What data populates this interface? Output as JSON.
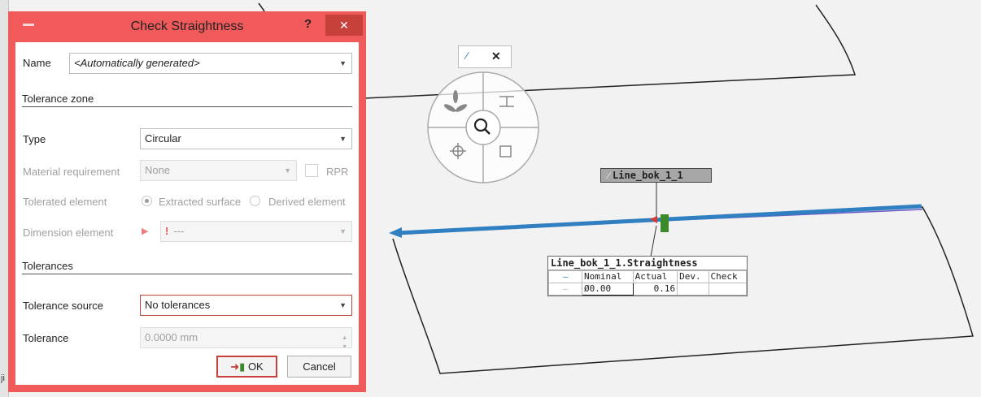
{
  "left_strip": {
    "char": "ji"
  },
  "dialog": {
    "title": "Check Straightness",
    "help_label": "?",
    "close_label": "✕",
    "name_label": "Name",
    "name_value": "<Automatically generated>",
    "tolerance_zone_heading": "Tolerance zone",
    "type_label": "Type",
    "type_value": "Circular",
    "material_requirement_label": "Material requirement",
    "material_requirement_value": "None",
    "rpr_label": "RPR",
    "tolerated_element_label": "Tolerated element",
    "tolerated_element_options": [
      "Extracted surface",
      "Derived element"
    ],
    "dimension_element_label": "Dimension element",
    "dimension_element_value": "---",
    "tolerances_heading": "Tolerances",
    "tolerance_source_label": "Tolerance source",
    "tolerance_source_value": "No tolerances",
    "tolerance_label": "Tolerance",
    "tolerance_value": "0.0000 mm",
    "ok_label": "OK",
    "cancel_label": "Cancel"
  },
  "viewport": {
    "tag_label": "Line_bok_1_1",
    "result": {
      "title": "Line_bok_1_1.Straightness",
      "headers": [
        "Nominal",
        "Actual",
        "Dev.",
        "Check"
      ],
      "nominal": "Ø0.00",
      "actual": "0.16",
      "dev": "",
      "check": ""
    }
  },
  "colors": {
    "dialog_border": "#f05a5a",
    "close_button": "#c7403a",
    "line_blue": "#2f7fc1",
    "marker_green": "#3a8a2a",
    "marker_red": "#d23b30"
  },
  "icons": {
    "mini_toolbar": [
      "line-icon",
      "close-icon"
    ],
    "view_wheel": [
      "rotate-icon",
      "pan-icon",
      "zoom-icon",
      "target-icon",
      "fit-icon"
    ]
  }
}
